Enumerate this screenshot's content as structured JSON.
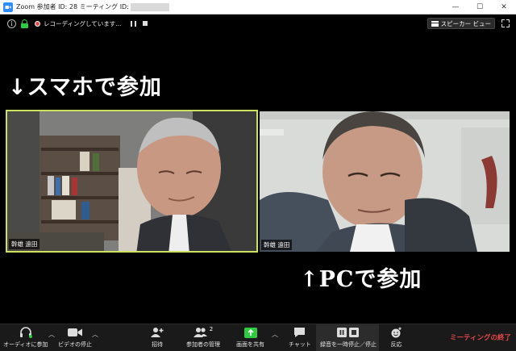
{
  "window": {
    "title": "Zoom 参加者 ID: 28 ミーティング ID:",
    "minimize": "—",
    "maximize": "☐",
    "close": "✕"
  },
  "infobar": {
    "recording_text": "レコーディングしています...",
    "speaker_view_label": "スピーカー ビュー"
  },
  "captions": {
    "top": "↓スマホで参加",
    "bottom": "↑PCで参加"
  },
  "tiles": [
    {
      "name": "幹雄 遠田"
    },
    {
      "name": "幹雄 遠田"
    }
  ],
  "toolbar": {
    "audio": "オーディオに参加",
    "video": "ビデオの停止",
    "invite": "招待",
    "participants": "参加者の管理",
    "participants_count": "2",
    "share": "画面を共有",
    "chat": "チャット",
    "recording": "録音を一時停止／停止",
    "reactions": "反応",
    "end": "ミーティングの終了"
  },
  "colors": {
    "active_speaker_border": "#cde062",
    "share_green": "#2ecc40",
    "end_red": "#e8474a",
    "zoom_blue": "#2D8CFF"
  }
}
